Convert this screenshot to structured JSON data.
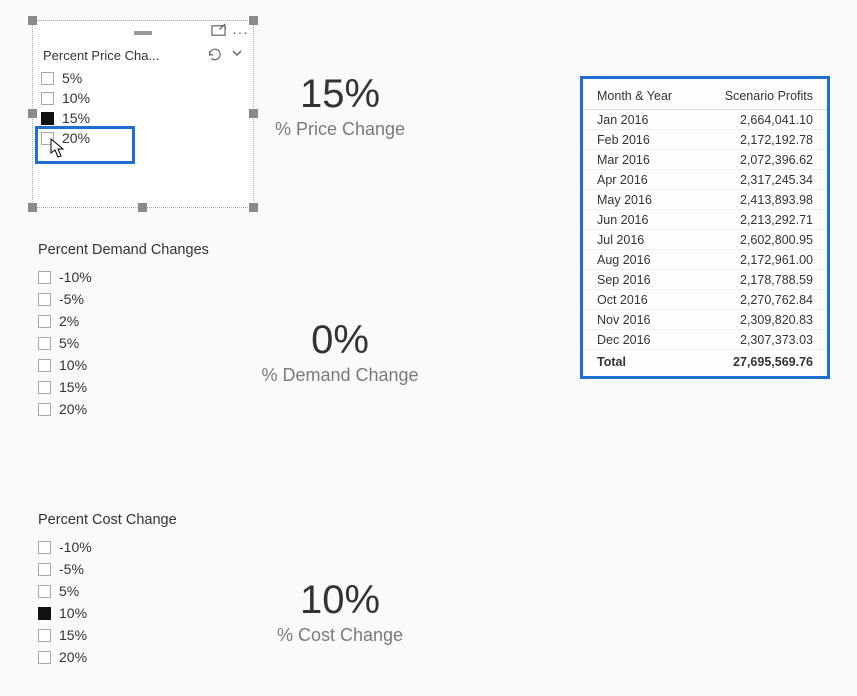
{
  "price_slicer": {
    "title": "Percent Price Cha...",
    "options": [
      "5%",
      "10%",
      "15%",
      "20%"
    ],
    "selected_index": 2
  },
  "demand_slicer": {
    "title": "Percent Demand Changes",
    "options": [
      "-10%",
      "-5%",
      "2%",
      "5%",
      "10%",
      "15%",
      "20%"
    ],
    "selected_index": -1
  },
  "cost_slicer": {
    "title": "Percent Cost Change",
    "options": [
      "-10%",
      "-5%",
      "5%",
      "10%",
      "15%",
      "20%"
    ],
    "selected_index": 3
  },
  "kpi_price": {
    "value": "15%",
    "label": "% Price Change"
  },
  "kpi_demand": {
    "value": "0%",
    "label": "% Demand Change"
  },
  "kpi_cost": {
    "value": "10%",
    "label": "% Cost Change"
  },
  "table": {
    "col1": "Month & Year",
    "col2": "Scenario Profits",
    "rows": [
      {
        "m": "Jan 2016",
        "v": "2,664,041.10"
      },
      {
        "m": "Feb 2016",
        "v": "2,172,192.78"
      },
      {
        "m": "Mar 2016",
        "v": "2,072,396.62"
      },
      {
        "m": "Apr 2016",
        "v": "2,317,245.34"
      },
      {
        "m": "May 2016",
        "v": "2,413,893.98"
      },
      {
        "m": "Jun 2016",
        "v": "2,213,292.71"
      },
      {
        "m": "Jul 2016",
        "v": "2,602,800.95"
      },
      {
        "m": "Aug 2016",
        "v": "2,172,961.00"
      },
      {
        "m": "Sep 2016",
        "v": "2,178,788.59"
      },
      {
        "m": "Oct 2016",
        "v": "2,270,762.84"
      },
      {
        "m": "Nov 2016",
        "v": "2,309,820.83"
      },
      {
        "m": "Dec 2016",
        "v": "2,307,373.03"
      }
    ],
    "total_label": "Total",
    "total_value": "27,695,569.76"
  },
  "chart_data": {
    "type": "table",
    "title": "Scenario Profits by Month & Year",
    "columns": [
      "Month & Year",
      "Scenario Profits"
    ],
    "rows": [
      [
        "Jan 2016",
        2664041.1
      ],
      [
        "Feb 2016",
        2172192.78
      ],
      [
        "Mar 2016",
        2072396.62
      ],
      [
        "Apr 2016",
        2317245.34
      ],
      [
        "May 2016",
        2413893.98
      ],
      [
        "Jun 2016",
        2213292.71
      ],
      [
        "Jul 2016",
        2602800.95
      ],
      [
        "Aug 2016",
        2172961.0
      ],
      [
        "Sep 2016",
        2178788.59
      ],
      [
        "Oct 2016",
        2270762.84
      ],
      [
        "Nov 2016",
        2309820.83
      ],
      [
        "Dec 2016",
        2307373.03
      ]
    ],
    "total": 27695569.76
  }
}
